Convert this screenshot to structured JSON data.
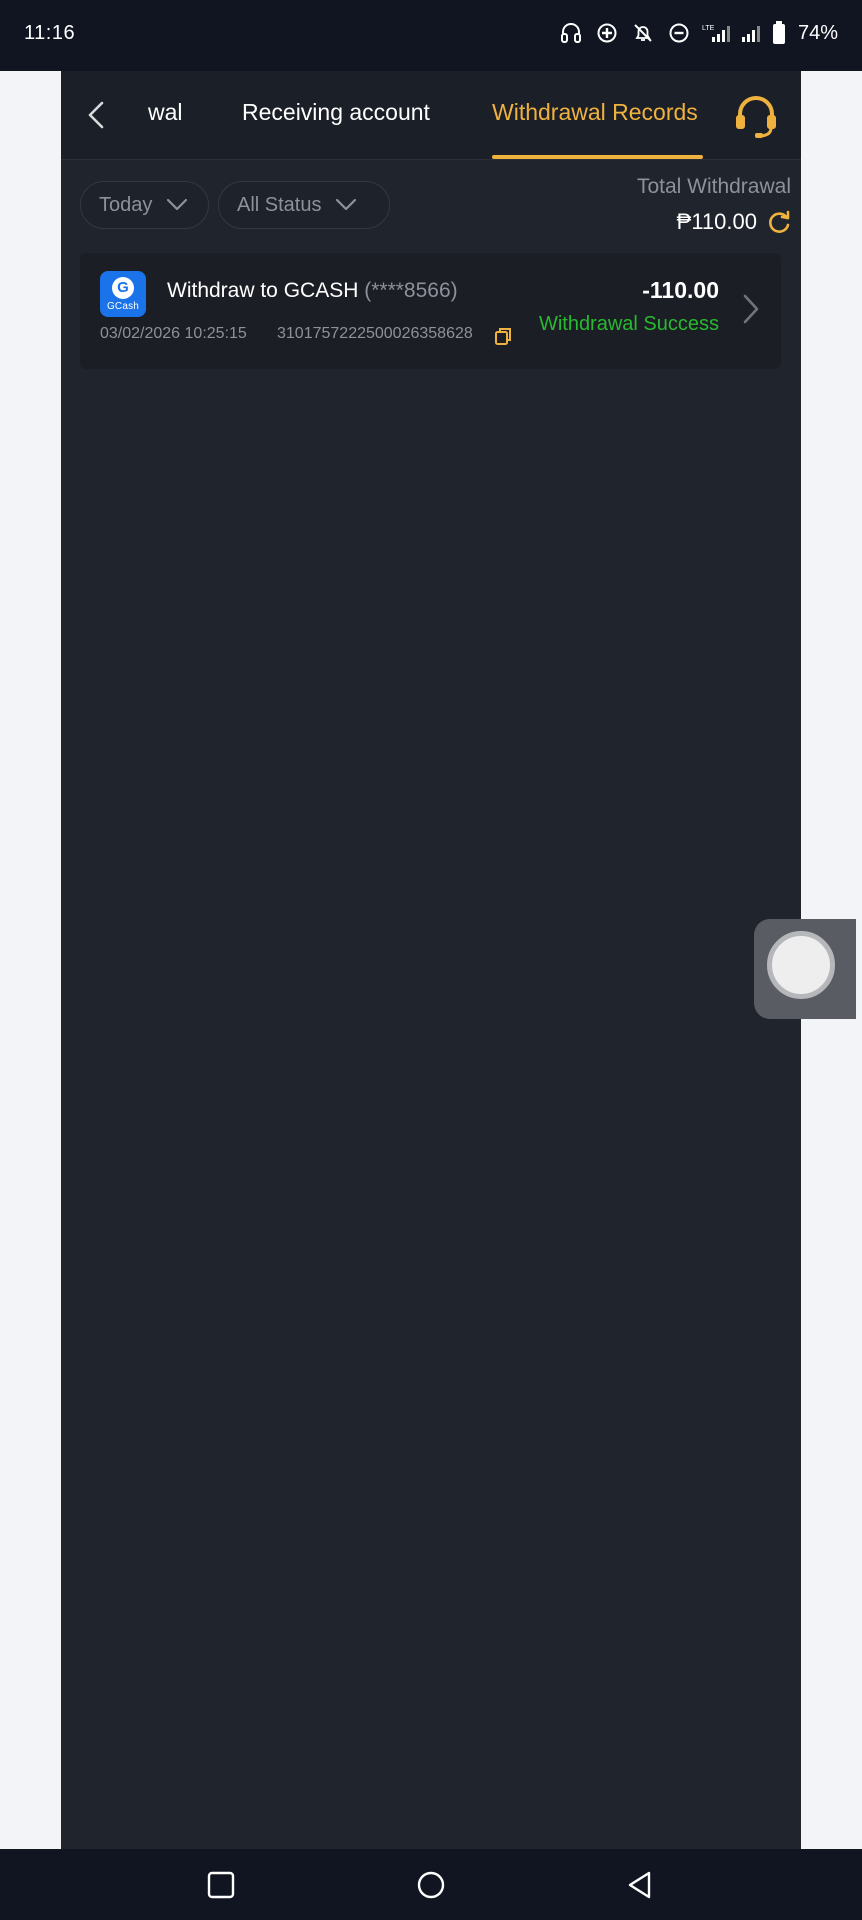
{
  "status_bar": {
    "time": "11:16",
    "battery": "74%",
    "icons": [
      "headphones-icon",
      "data-saver-icon",
      "bell-off-icon",
      "do-not-disturb-icon",
      "signal-lte-icon",
      "signal-icon",
      "battery-icon"
    ]
  },
  "header": {
    "tabs": [
      {
        "label": "wal",
        "active": false
      },
      {
        "label": "Receiving account",
        "active": false
      },
      {
        "label": "Withdrawal Records",
        "active": true
      }
    ],
    "accent_color": "#f0b23f"
  },
  "filters": {
    "date": "Today",
    "status": "All Status"
  },
  "summary": {
    "total_label": "Total Withdrawal",
    "total_amount": "₱110.00"
  },
  "records": [
    {
      "logo_text": "GCash",
      "logo_letter": "G",
      "title": "Withdraw to GCASH",
      "account": "(****8566)",
      "datetime": "03/02/2026 10:25:15",
      "transaction_id": "3101757222500026358628",
      "amount": "-110.00",
      "status": "Withdrawal Success",
      "status_color": "#28b930"
    }
  ]
}
